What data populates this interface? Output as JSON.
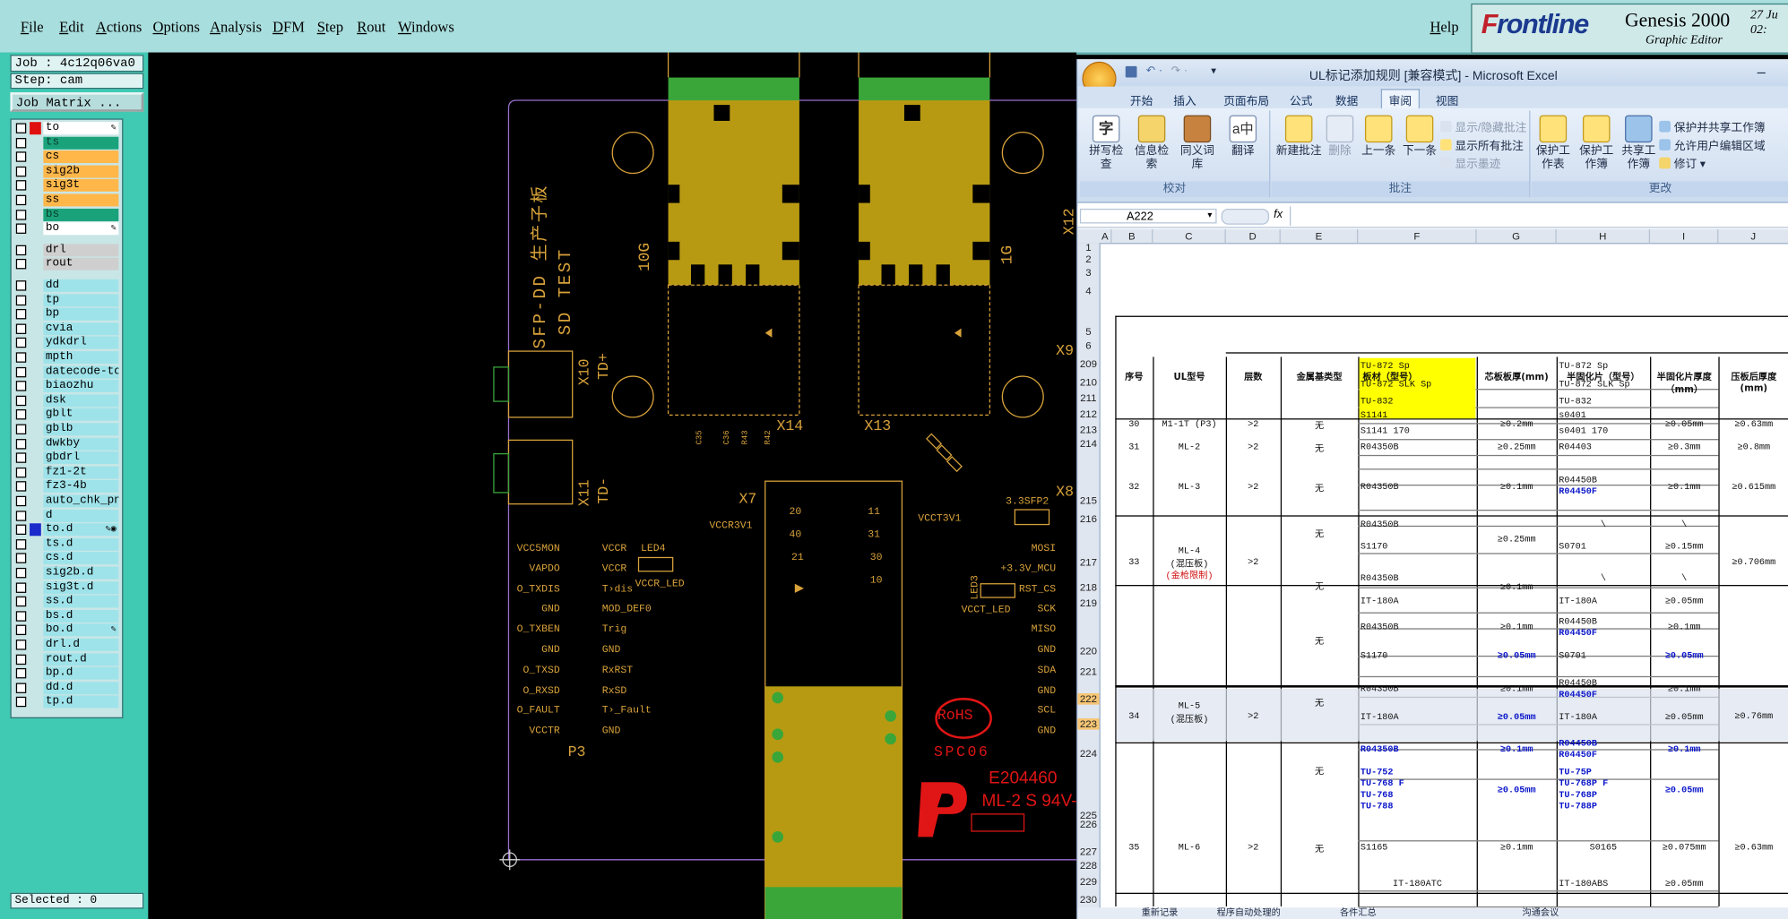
{
  "menu": [
    "File",
    "Edit",
    "Actions",
    "Options",
    "Analysis",
    "DFM",
    "Step",
    "Rout",
    "Windows"
  ],
  "help": "Help",
  "brand": {
    "logo_a": "F",
    "logo_b": "rontline",
    "product": "Genesis 2000",
    "subtitle": "Graphic Editor",
    "date_line1": "27 Ju",
    "date_line2": "02:"
  },
  "left": {
    "job": "Job : 4c12q06va0",
    "step": "Step: cam",
    "matrix_btn": "Job Matrix ...",
    "selected": "Selected : 0",
    "layers": [
      {
        "name": "to",
        "bg": "#ffffff",
        "mark": "#e01010",
        "icon": "pen"
      },
      {
        "name": "ts",
        "bg": "#1aa37a",
        "mark": ""
      },
      {
        "name": "cs",
        "bg": "#ffb74a",
        "mark": ""
      },
      {
        "name": "sig2b",
        "bg": "#ffb74a",
        "mark": ""
      },
      {
        "name": "sig3t",
        "bg": "#ffb74a",
        "mark": ""
      },
      {
        "name": "ss",
        "bg": "#ffb74a",
        "mark": ""
      },
      {
        "name": "bs",
        "bg": "#1aa37a",
        "mark": ""
      },
      {
        "name": "bo",
        "bg": "#ffffff",
        "mark": "",
        "icon": "pen"
      },
      {
        "name": "drl",
        "bg": "#cfcfcf",
        "mark": ""
      },
      {
        "name": "rout",
        "bg": "#cfcfcf",
        "mark": ""
      },
      {
        "name": "dd",
        "bg": "#9fe3ea",
        "mark": ""
      },
      {
        "name": "tp",
        "bg": "#9fe3ea",
        "mark": ""
      },
      {
        "name": "bp",
        "bg": "#9fe3ea",
        "mark": ""
      },
      {
        "name": "cvia",
        "bg": "#9fe3ea",
        "mark": ""
      },
      {
        "name": "ydkdrl",
        "bg": "#9fe3ea",
        "mark": ""
      },
      {
        "name": "mpth",
        "bg": "#9fe3ea",
        "mark": ""
      },
      {
        "name": "datecode-to",
        "bg": "#9fe3ea",
        "mark": ""
      },
      {
        "name": "biaozhu",
        "bg": "#9fe3ea",
        "mark": ""
      },
      {
        "name": "dsk",
        "bg": "#9fe3ea",
        "mark": ""
      },
      {
        "name": "gblt",
        "bg": "#9fe3ea",
        "mark": ""
      },
      {
        "name": "gblb",
        "bg": "#9fe3ea",
        "mark": ""
      },
      {
        "name": "dwkby",
        "bg": "#9fe3ea",
        "mark": ""
      },
      {
        "name": "gbdrl",
        "bg": "#9fe3ea",
        "mark": ""
      },
      {
        "name": "fz1-2t",
        "bg": "#9fe3ea",
        "mark": ""
      },
      {
        "name": "fz3-4b",
        "bg": "#9fe3ea",
        "mark": ""
      },
      {
        "name": "auto_chk_pn",
        "bg": "#9fe3ea",
        "mark": ""
      },
      {
        "name": "d",
        "bg": "#9fe3ea",
        "mark": ""
      },
      {
        "name": "to.d",
        "bg": "#9fe3ea",
        "mark": "#1a2acb",
        "icon": "pen2"
      },
      {
        "name": "ts.d",
        "bg": "#9fe3ea",
        "mark": ""
      },
      {
        "name": "cs.d",
        "bg": "#9fe3ea",
        "mark": ""
      },
      {
        "name": "sig2b.d",
        "bg": "#9fe3ea",
        "mark": ""
      },
      {
        "name": "sig3t.d",
        "bg": "#9fe3ea",
        "mark": ""
      },
      {
        "name": "ss.d",
        "bg": "#9fe3ea",
        "mark": ""
      },
      {
        "name": "bs.d",
        "bg": "#9fe3ea",
        "mark": ""
      },
      {
        "name": "bo.d",
        "bg": "#9fe3ea",
        "mark": "",
        "icon": "pen"
      },
      {
        "name": "drl.d",
        "bg": "#9fe3ea",
        "mark": ""
      },
      {
        "name": "rout.d",
        "bg": "#9fe3ea",
        "mark": ""
      },
      {
        "name": "bp.d",
        "bg": "#9fe3ea",
        "mark": ""
      },
      {
        "name": "dd.d",
        "bg": "#9fe3ea",
        "mark": ""
      },
      {
        "name": "tp.d",
        "bg": "#9fe3ea",
        "mark": ""
      }
    ]
  },
  "board": {
    "vtitle1": "SFP-DD 生产子板",
    "vtitle2": "SD TEST",
    "cage_left": "10G",
    "cage_right": "1G",
    "x14": "X14",
    "x13": "X13",
    "x10": "X10",
    "td_plus": "TD+",
    "x11": "X11",
    "td_minus": "TD-",
    "x7": "X7",
    "x9": "X9",
    "x8": "X8",
    "x12": "X12",
    "p3": "P3",
    "led4": "LED4",
    "led3": "LED3",
    "sfp2": "3.3SFP2",
    "vccr3v1": "VCCR3V1",
    "vcct3v1": "VCCT3V1",
    "pins_left": [
      "VCC5MON",
      "VAPDO",
      "O_TXDIS",
      "GND",
      "O_TXBEN",
      "GND",
      "O_TXSD",
      "O_RXSD",
      "O_FAULT",
      "VCCTR"
    ],
    "pins_mid": [
      "VCCR",
      "VCCR",
      "T›dis",
      "MOD_DEF0",
      "Trig",
      "GND",
      "RxRST",
      "RxSD",
      "T›_Fault",
      "GND"
    ],
    "mid_extra": "VCCR_LED",
    "pins_right": [
      "MOSI",
      "+3.3V_MCU",
      "RST_CS",
      "SCK",
      "MISO",
      "GND",
      "SDA",
      "GND",
      "SCL",
      "GND"
    ],
    "vcct_led": "VCCT_LED",
    "conn_nums": [
      "20",
      "11",
      "40",
      "31",
      "21",
      "30",
      "10"
    ],
    "comp_labels": [
      "C35",
      "C36",
      "R43",
      "R42"
    ],
    "rohs": "RoHS",
    "spc": "SPC06",
    "ul_code": "E204460",
    "ul_rating": "ML-2 S 94V-"
  },
  "excel": {
    "title": "UL标记添加规则  [兼容模式] - Microsoft Excel",
    "tabs": [
      "开始",
      "插入",
      "页面布局",
      "公式",
      "数据",
      "审阅",
      "视图"
    ],
    "active_tab": "审阅",
    "groups": {
      "proof": "校对",
      "comments": "批注",
      "changes": "更改"
    },
    "proof_btns": [
      "拼写检查",
      "信息检索",
      "同义词库",
      "翻译"
    ],
    "comment_btns": [
      "新建批注",
      "删除",
      "上一条",
      "下一条"
    ],
    "comment_small": [
      "显示/隐藏批注",
      "显示所有批注",
      "显示墨迹"
    ],
    "change_btns": [
      "保护工作表",
      "保护工作簿",
      "共享工作簿"
    ],
    "change_small": [
      "保护并共享工作簿",
      "允许用户编辑区域",
      "修订"
    ],
    "namebox": "A222",
    "fx": "fx",
    "cols": [
      "A",
      "B",
      "C",
      "D",
      "E",
      "F",
      "G",
      "H",
      "I",
      "J"
    ],
    "rows": [
      "1",
      "2",
      "3",
      "4",
      "5",
      "6",
      "209",
      "210",
      "211",
      "212",
      "213",
      "214",
      "215",
      "216",
      "217",
      "218",
      "219",
      "220",
      "221",
      "222",
      "223",
      "224",
      "225",
      "226",
      "227",
      "228",
      "229",
      "230"
    ],
    "headers": [
      "序号",
      "UL型号",
      "层数",
      "金属基类型",
      "板材（型号）",
      "芯板板厚(mm)",
      "半固化片（型号）",
      "半固化片厚度（mm）",
      "压板后厚度(mm)"
    ],
    "sheet_tabs": [
      "重新记录",
      "程序自动处理的",
      "各件汇总",
      "沟通会议"
    ]
  },
  "cells": {
    "r209f": "TU-872 Sp",
    "r209h": "TU-872 Sp",
    "r210f": "TU-872 SLK Sp",
    "r210h": "TU-872 SLK Sp",
    "r211f": "TU-832",
    "r211h": "TU-832",
    "r212b": "30",
    "r212c": "M1-1T (P3)",
    "r212d": ">2",
    "r212e": "无",
    "r212f": "S1141",
    "r212g": "≥0.2mm",
    "r212h": "s0401",
    "r212i": "≥0.05mm",
    "r212j": "≥0.63mm",
    "r213f": "S1141 170",
    "r213h": "s0401 170",
    "r214b": "31",
    "r214c": "ML-2",
    "r214d": ">2",
    "r214e": "无",
    "r214f": "R04350B",
    "r214g": "≥0.25mm",
    "r214h": "R04403",
    "r214i": "≥0.3mm",
    "r214j": "≥0.8mm",
    "r215b": "32",
    "r215c": "ML-3",
    "r215d": ">2",
    "r215e": "无",
    "r215f": "R04350B",
    "r215g": "≥0.1mm",
    "r215h1": "R04450B",
    "r215h2": "R04450F",
    "r215i": "≥0.1mm",
    "r215j": "≥0.615mm",
    "r216f": "R04350B",
    "r216h": "\\",
    "r216i": "\\",
    "r217b": "33",
    "r217c1": "ML-4",
    "r217c2": "(混压板)",
    "r217c3": "(金枪限制)",
    "r217d": ">2",
    "r217e": "无",
    "r217f": "S1170",
    "r217g": "≥0.25mm",
    "r217h": "S0701",
    "r217i": "≥0.15mm",
    "r217j": "≥0.706mm",
    "r218e": "无",
    "r218f": "R04350B",
    "r218g": "≥0.1mm",
    "r218h": "\\",
    "r218i": "\\",
    "r219f": "IT-180A",
    "r219h": "IT-180A",
    "r219i": "≥0.05mm",
    "r220f": "R04350B",
    "r220g": "≥0.1mm",
    "r220h1": "R04450B",
    "r220h2": "R04450F",
    "r220i": "≥0.1mm",
    "r221e": "无",
    "r221f": "S1170",
    "r221g": "≥0.05mm",
    "r221h": "S0701",
    "r221i": "≥0.05mm",
    "r222b": "34",
    "r222c1": "ML-5",
    "r222c2": "(混压板)",
    "r222d": ">2",
    "r222e": "无",
    "r222f": "R04350B",
    "r222g": "≥0.1mm",
    "r222h1": "R04450B",
    "r222h2": "R04450F",
    "r222i": "≥0.1mm",
    "r222j": "≥0.76mm",
    "r223f": "IT-180A",
    "r223g": "≥0.05mm",
    "r223h": "IT-180A",
    "r223i": "≥0.05mm",
    "r224f": "R04350B",
    "r224g": "≥0.1mm",
    "r224h1": "R04450B",
    "r224h2": "R04450F",
    "r224i": "≥0.1mm",
    "r225e": "无",
    "r225f1": "TU-752",
    "r225f2": "TU-768 F",
    "r225f3": "TU-768",
    "r225f4": "TU-788",
    "r225g": "≥0.05mm",
    "r225h1": "TU-75P",
    "r225h2": "TU-768P F",
    "r225h3": "TU-768P",
    "r225h4": "TU-788P",
    "r225i": "≥0.05mm",
    "r227b": "35",
    "r227c": "ML-6",
    "r227d": ">2",
    "r227e": "无",
    "r227f": "S1165",
    "r227g": "≥0.1mm",
    "r227h": "S0165",
    "r227i": "≥0.075mm",
    "r227j": "≥0.63mm",
    "r230f": "IT-180ATC",
    "r230h": "IT-180ABS",
    "r230i": "≥0.05mm"
  }
}
